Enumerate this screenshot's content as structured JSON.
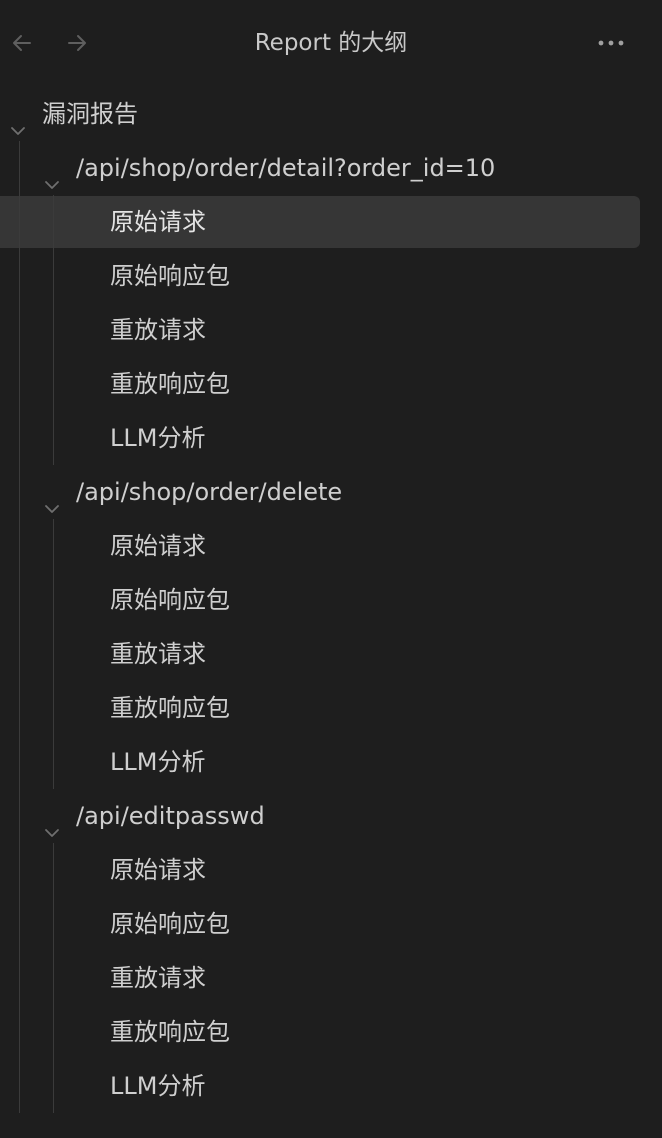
{
  "header": {
    "title": "Report 的大纲",
    "back_icon": "arrow-left-icon",
    "forward_icon": "arrow-right-icon",
    "more_icon": "more-horizontal-icon"
  },
  "outline": {
    "root": {
      "label": "漏洞报告",
      "expanded": true,
      "sections": [
        {
          "label": "/api/shop/order/detail?order_id=10",
          "expanded": true,
          "items": [
            "原始请求",
            "原始响应包",
            "重放请求",
            "重放响应包",
            "LLM分析"
          ],
          "selected_index": 0
        },
        {
          "label": "/api/shop/order/delete",
          "expanded": true,
          "items": [
            "原始请求",
            "原始响应包",
            "重放请求",
            "重放响应包",
            "LLM分析"
          ]
        },
        {
          "label": "/api/editpasswd",
          "expanded": true,
          "items": [
            "原始请求",
            "原始响应包",
            "重放请求",
            "重放响应包",
            "LLM分析"
          ]
        }
      ]
    }
  },
  "colors": {
    "background": "#1e1e1e",
    "text": "#cfcfcf",
    "selected_background": "#363636",
    "guide_line": "#3b3b3b",
    "icon": "#6f6f6f"
  }
}
